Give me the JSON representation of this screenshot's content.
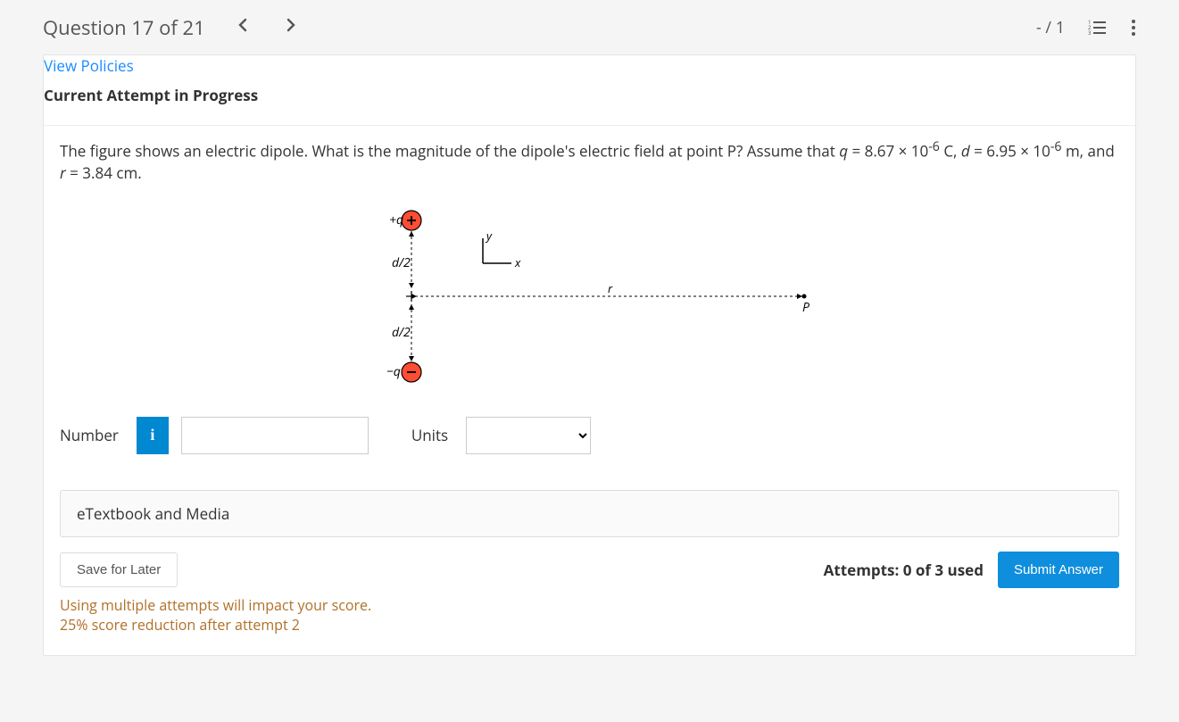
{
  "header": {
    "title": "Question 17 of 21",
    "score": "- / 1"
  },
  "policies_link": "View Policies",
  "attempt_status": "Current Attempt in Progress",
  "question": {
    "prefix": "The figure shows an electric dipole. What is the magnitude of the dipole's electric field at point P? Assume that ",
    "q_val": "8.67 × 10",
    "q_exp": "-6",
    "q_unit": " C, ",
    "d_val": "6.95 × 10",
    "d_exp": "-6",
    "d_unit": " m, and ",
    "r_val": "3.84 cm."
  },
  "figure": {
    "plus_label": "+q",
    "minus_label": "−q",
    "d2a": "d/2",
    "d2b": "d/2",
    "y": "y",
    "x": "x",
    "r": "r",
    "P": "P"
  },
  "answer": {
    "number_label": "Number",
    "info": "i",
    "units_label": "Units",
    "input_value": "",
    "units_value": ""
  },
  "etextbook_label": "eTextbook and Media",
  "save_later_label": "Save for Later",
  "attempts_label": "Attempts: 0 of 3 used",
  "submit_label": "Submit Answer",
  "notice_line1": "Using multiple attempts will impact your score.",
  "notice_line2": "25% score reduction after attempt 2"
}
